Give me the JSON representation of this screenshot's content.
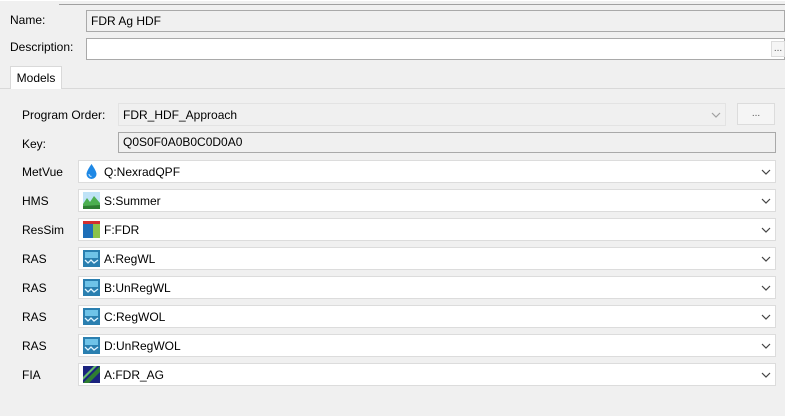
{
  "name": {
    "label": "Name:",
    "value": "FDR Ag HDF"
  },
  "description": {
    "label": "Description:",
    "value": "",
    "button": "..."
  },
  "tabs": [
    {
      "label": "Models"
    }
  ],
  "program_order": {
    "label": "Program Order:",
    "value": "FDR_HDF_Approach",
    "button": "..."
  },
  "key": {
    "label": "Key:",
    "value": "Q0S0F0A0B0C0D0A0"
  },
  "models": [
    {
      "label": "MetVue",
      "value": "Q:NexradQPF",
      "icon": "metvue-drop-icon"
    },
    {
      "label": "HMS",
      "value": "S:Summer",
      "icon": "hms-icon"
    },
    {
      "label": "ResSim",
      "value": "F:FDR",
      "icon": "ressim-icon"
    },
    {
      "label": "RAS",
      "value": "A:RegWL",
      "icon": "ras-icon"
    },
    {
      "label": "RAS",
      "value": "B:UnRegWL",
      "icon": "ras-icon"
    },
    {
      "label": "RAS",
      "value": "C:RegWOL",
      "icon": "ras-icon"
    },
    {
      "label": "RAS",
      "value": "D:UnRegWOL",
      "icon": "ras-icon"
    },
    {
      "label": "FIA",
      "value": "A:FDR_AG",
      "icon": "fia-icon"
    }
  ]
}
